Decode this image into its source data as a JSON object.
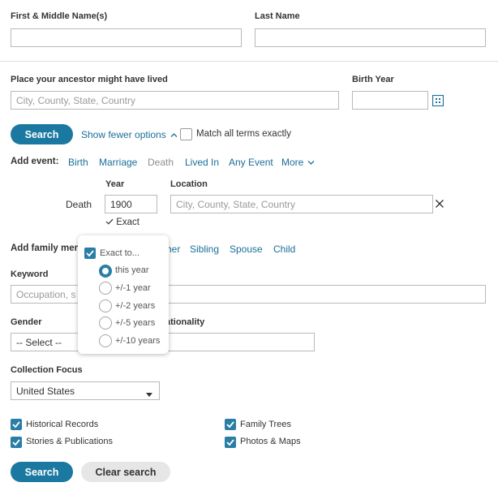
{
  "name": {
    "first_label": "First & Middle Name(s)",
    "first_value": "",
    "last_label": "Last Name",
    "last_value": ""
  },
  "place": {
    "label": "Place your ancestor might have lived",
    "placeholder": "City, County, State, Country"
  },
  "birth_year": {
    "label": "Birth Year",
    "value": "",
    "calendar_icon": "calendar-grid-icon"
  },
  "search_row": {
    "search_label": "Search",
    "fewer_options_label": "Show fewer options",
    "match_all_label": "Match all terms exactly"
  },
  "add_event": {
    "label": "Add event:",
    "items": [
      "Birth",
      "Marriage",
      "Death",
      "Lived In",
      "Any Event",
      "More"
    ]
  },
  "death_event": {
    "year_header": "Year",
    "location_header": "Location",
    "row_label": "Death",
    "year_value": "1900",
    "location_placeholder": "City, County, State, Country",
    "exact_label": "Exact"
  },
  "exact_popup": {
    "header": "Exact to...",
    "options": [
      "this year",
      "+/-1 year",
      "+/-2 years",
      "+/-5 years",
      "+/-10 years"
    ],
    "selected": "this year"
  },
  "add_family": {
    "label_visible": "Add family mem",
    "items_visible": [
      "her",
      "Sibling",
      "Spouse",
      "Child"
    ]
  },
  "keyword": {
    "label": "Keyword",
    "placeholder_visible": "Occupation, s"
  },
  "gender": {
    "label": "Gender",
    "selected": "-- Select --"
  },
  "nationality": {
    "label_visible": "ationality"
  },
  "collection_focus": {
    "label": "Collection Focus",
    "selected": "United States"
  },
  "filters": [
    {
      "label": "Historical Records",
      "checked": true
    },
    {
      "label": "Family Trees",
      "checked": true
    },
    {
      "label": "Stories & Publications",
      "checked": true
    },
    {
      "label": "Photos & Maps",
      "checked": true
    }
  ],
  "footer": {
    "search_label": "Search",
    "clear_label": "Clear search"
  }
}
